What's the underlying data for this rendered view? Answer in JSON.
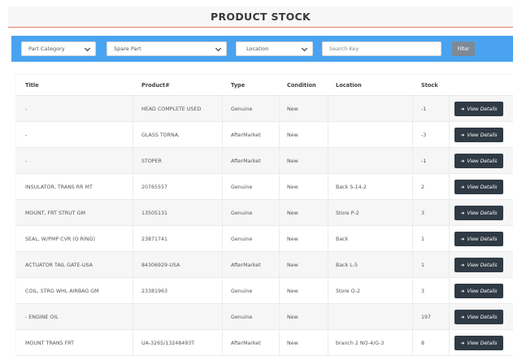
{
  "header": {
    "title": "PRODUCT STOCK"
  },
  "filters": {
    "part_category": "Part Category",
    "spare_part": "Spare Part",
    "location": "Location",
    "search_placeholder": "Search Key",
    "filter_label": "Filter"
  },
  "table": {
    "columns": [
      "Title",
      "Product#",
      "Type",
      "Condition",
      "Location",
      "Stock"
    ],
    "view_label": "View Details",
    "rows": [
      {
        "title": "-",
        "product": "HEAD COMPLETE USED",
        "type": "Genuine",
        "condition": "New",
        "location": "",
        "stock": "-1"
      },
      {
        "title": "-",
        "product": "GLASS TORNA.",
        "type": "AfterMarket",
        "condition": "New",
        "location": "",
        "stock": "-3"
      },
      {
        "title": "-",
        "product": "STOPER",
        "type": "AfterMarket",
        "condition": "New",
        "location": "",
        "stock": "-1"
      },
      {
        "title": "INSULATOR, TRANS RR MT",
        "product": "20765557",
        "type": "Genuine",
        "condition": "New",
        "location": "Back S-14-2",
        "stock": "2"
      },
      {
        "title": "MOUNT, FRT STRUT GM",
        "product": "13505131",
        "type": "Genuine",
        "condition": "New",
        "location": "Store P-2",
        "stock": "3"
      },
      {
        "title": "SEAL, W/PMP CVR (O RING)",
        "product": "23871741",
        "type": "Genuine",
        "condition": "New",
        "location": "Back",
        "stock": "1"
      },
      {
        "title": "ACTUATOR TAIL GATE-USA",
        "product": "84306929-USA",
        "type": "AfterMarket",
        "condition": "New",
        "location": "Back L-5",
        "stock": "1"
      },
      {
        "title": "COIL, STRG WHL AIRBAG GM",
        "product": "23381963",
        "type": "Genuine",
        "condition": "New",
        "location": "Store O-2",
        "stock": "3"
      },
      {
        "title": "- ENGINE OIL",
        "product": "",
        "type": "Genuine",
        "condition": "New",
        "location": "",
        "stock": "197"
      },
      {
        "title": "MOUNT TRANS FRT",
        "product": "UA-3265/13248493T",
        "type": "AfterMarket",
        "condition": "New",
        "location": "branch 2 NO-4/G-3",
        "stock": "8"
      }
    ]
  }
}
